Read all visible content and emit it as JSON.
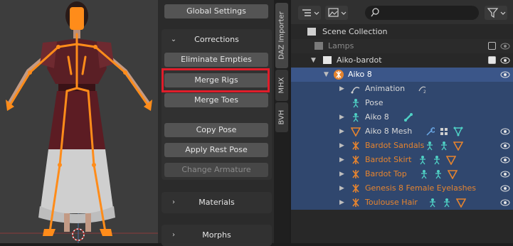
{
  "npanel": {
    "global_settings": "Global Settings",
    "corrections": {
      "title": "Corrections",
      "eliminate_empties": "Eliminate Empties",
      "merge_rigs": "Merge Rigs",
      "merge_toes": "Merge Toes",
      "copy_pose": "Copy Pose",
      "apply_rest_pose": "Apply Rest Pose",
      "change_armature": "Change Armature"
    },
    "materials": "Materials",
    "morphs": "Morphs"
  },
  "tabs": [
    "DAZ Importer",
    "MHX",
    "BVH"
  ],
  "outliner": {
    "scene_collection": "Scene Collection",
    "lamps": "Lamps",
    "collection": "Aiko-bardot",
    "armature": "Aiko 8",
    "animation": "Animation",
    "pose": "Pose",
    "armature_data": "Aiko 8",
    "mesh": "Aiko 8 Mesh",
    "children": [
      "Bardot Sandals",
      "Bardot Skirt",
      "Bardot Top",
      "Genesis 8 Female Eyelashes",
      "Toulouse Hair"
    ]
  },
  "colors": {
    "highlight": "#e01d2a",
    "selected_row": "#3b5689",
    "orange_text": "#e5842f",
    "bone_orange": "#ff8c1a"
  }
}
